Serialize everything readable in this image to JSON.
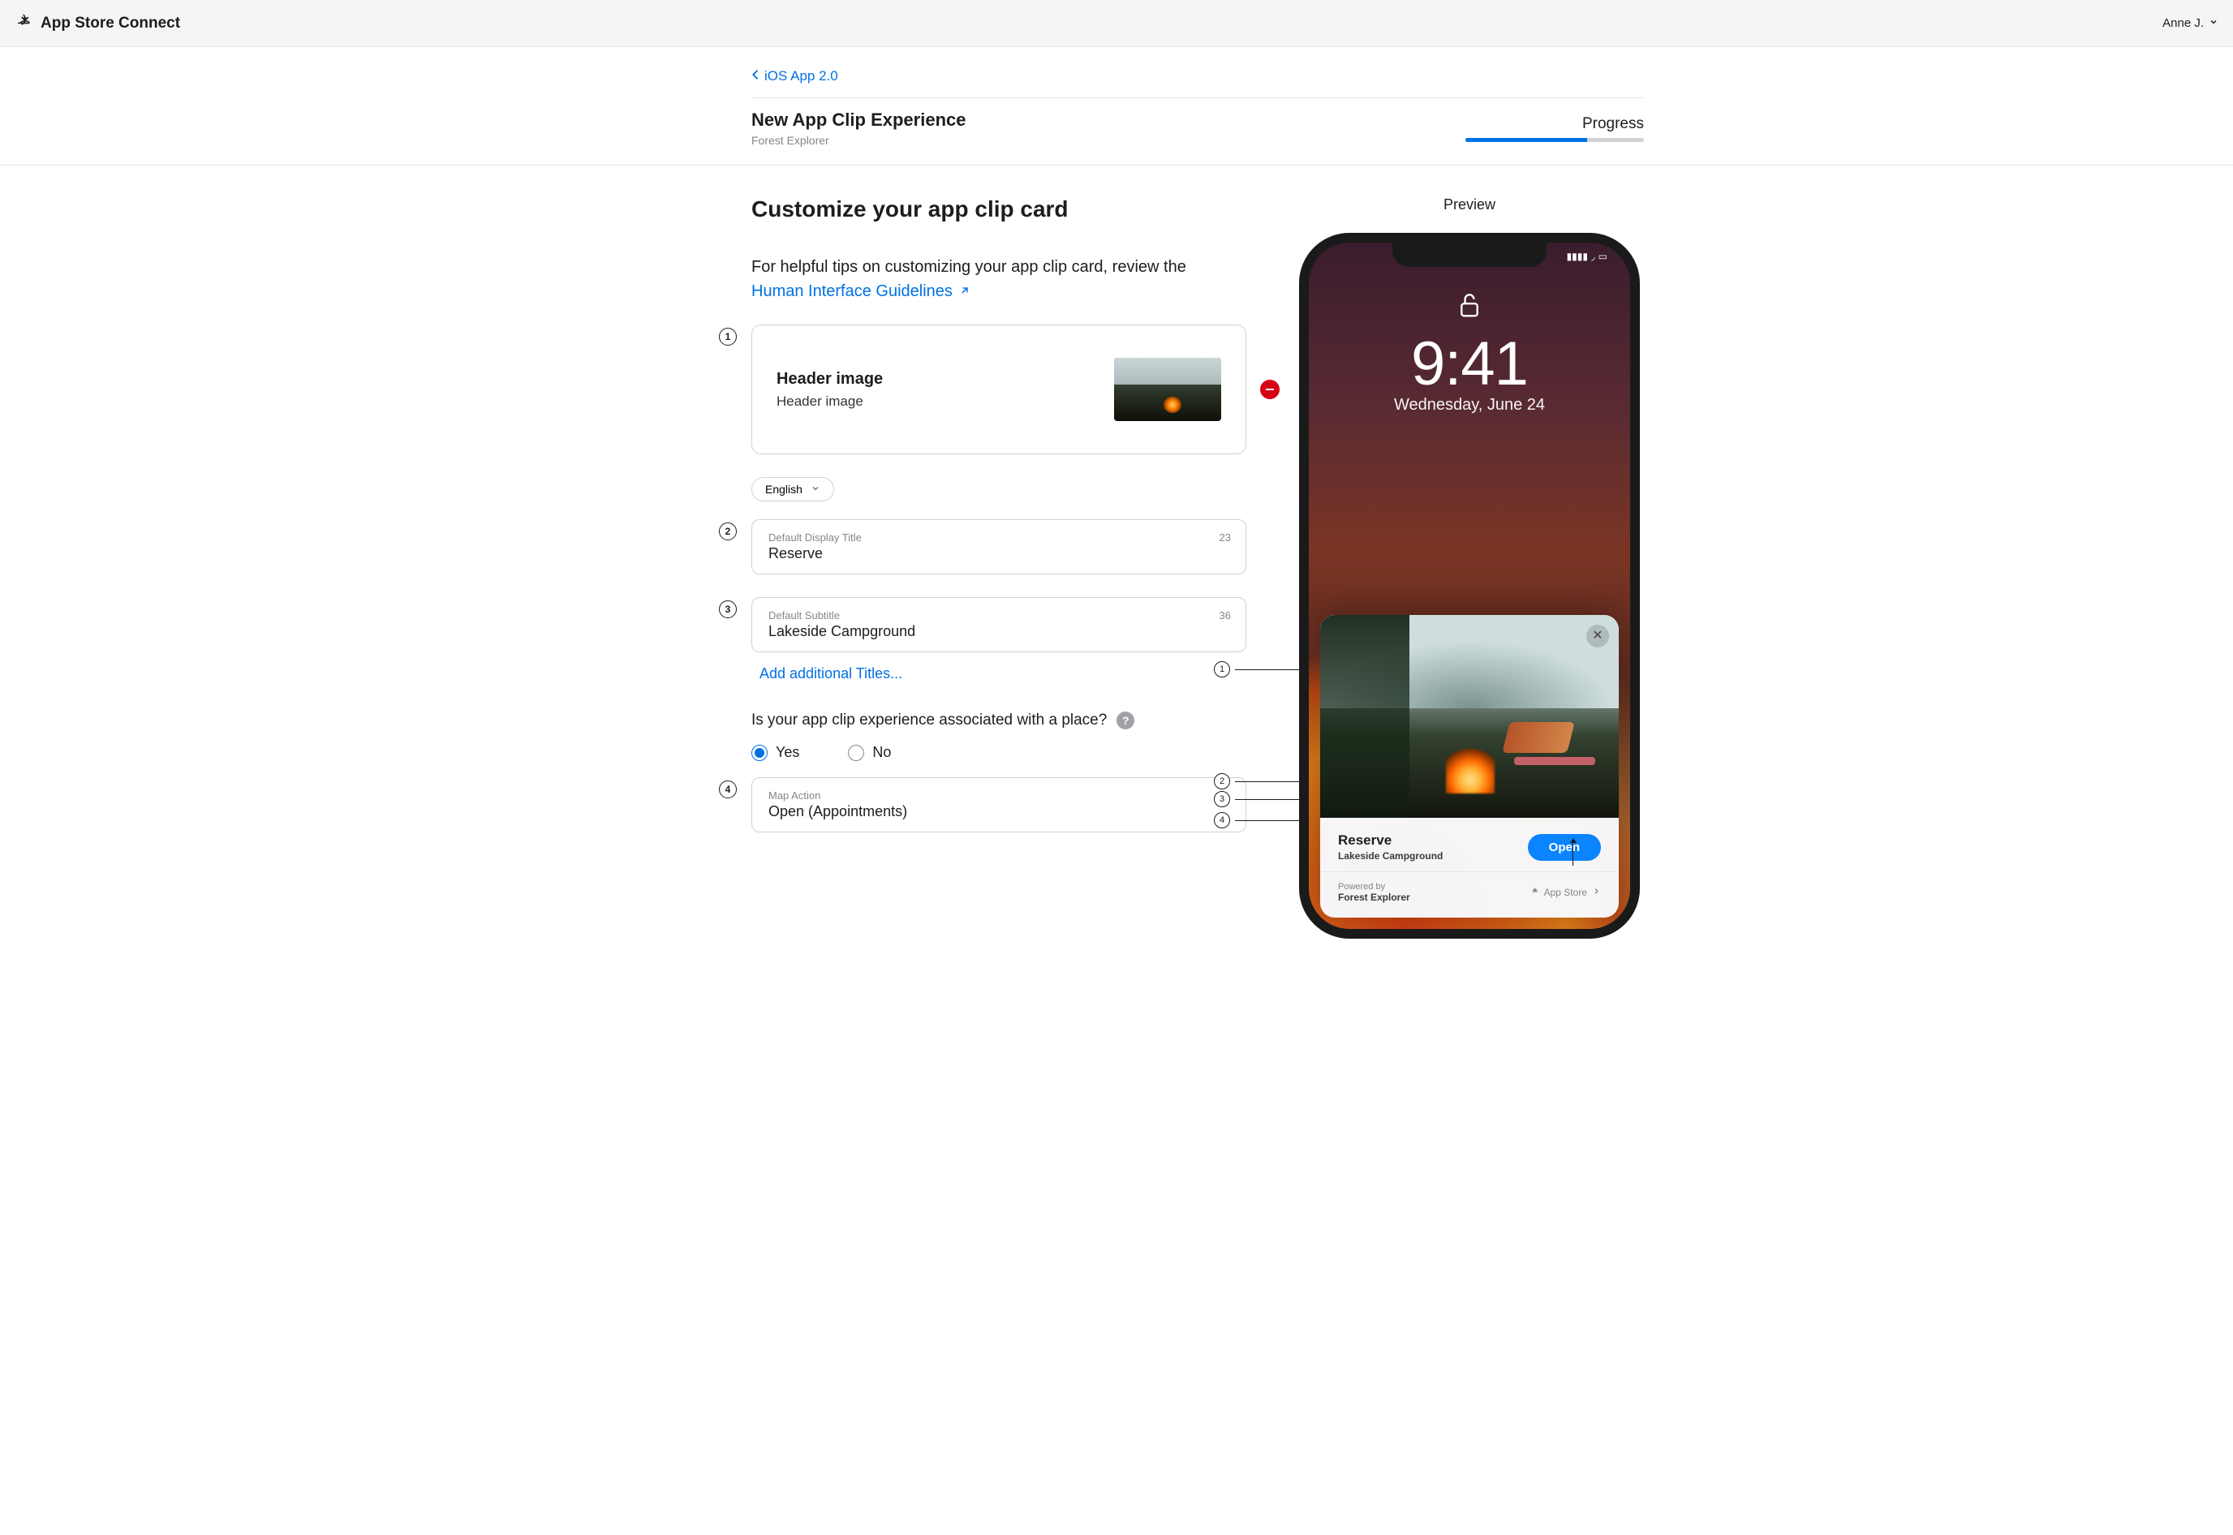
{
  "header": {
    "brand": "App Store Connect",
    "user": "Anne J."
  },
  "breadcrumb": {
    "back_label": "iOS App 2.0"
  },
  "page": {
    "title": "New App Clip Experience",
    "app_name": "Forest Explorer",
    "progress_label": "Progress",
    "progress_percent": 68
  },
  "form": {
    "heading": "Customize your app clip card",
    "intro_text": "For helpful tips on customizing your app clip card, review the ",
    "intro_link": "Human Interface Guidelines",
    "header_image": {
      "title": "Header image",
      "subtitle": "Header image"
    },
    "language": {
      "selected": "English"
    },
    "title_field": {
      "label": "Default Display Title",
      "value": "Reserve",
      "remaining": "23"
    },
    "subtitle_field": {
      "label": "Default Subtitle",
      "value": "Lakeside Campground",
      "remaining": "36"
    },
    "add_titles_link": "Add additional Titles...",
    "place_question": "Is your app clip experience associated with a place?",
    "yes_label": "Yes",
    "no_label": "No",
    "place_selected": "yes",
    "map_action": {
      "label": "Map Action",
      "value": "Open (Appointments)"
    }
  },
  "preview": {
    "heading": "Preview",
    "lock_time": "9:41",
    "lock_date": "Wednesday, June 24",
    "card_title": "Reserve",
    "card_subtitle": "Lakeside Campground",
    "action_button": "Open",
    "powered_label": "Powered by",
    "powered_app": "Forest Explorer",
    "appstore_label": "App Store"
  },
  "step_labels": [
    "1",
    "2",
    "3",
    "4"
  ]
}
